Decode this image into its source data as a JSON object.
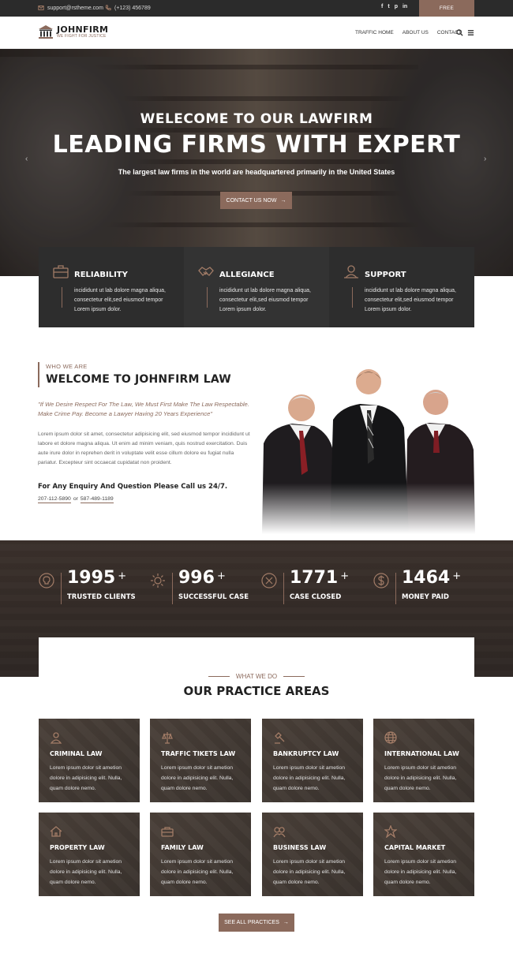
{
  "topbar": {
    "email": "support@rstheme.com",
    "phone": "(+123) 456789",
    "social": [
      "f",
      "t",
      "p",
      "in"
    ],
    "consult_label": "FREE CONSULTATION"
  },
  "header": {
    "logo_title": "JOHNFIRM",
    "logo_tagline": "WE FIGHT FOR JUSTICE",
    "nav": [
      "TRAFFIC HOME",
      "ABOUT US",
      "CONTACT"
    ]
  },
  "hero": {
    "subtitle": "WELECOME TO OUR LAWFIRM",
    "title": "LEADING FIRMS WITH EXPERT",
    "description": "The largest law firms in the world are headquartered primarily in the United States",
    "button_label": "CONTACT US NOW"
  },
  "features": [
    {
      "title": "RELIABILITY",
      "text": "incididunt ut lab dolore magna aliqua, consectetur elit,sed eiusmod tempor Lorem ipsum dolor.",
      "icon": "briefcase-icon"
    },
    {
      "title": "ALLEGIANCE",
      "text": "incididunt ut lab dolore magna aliqua, consectetur elit,sed eiusmod tempor Lorem ipsum dolor.",
      "icon": "handshake-icon"
    },
    {
      "title": "SUPPORT",
      "text": "incididunt ut lab dolore magna aliqua, consectetur elit,sed eiusmod tempor Lorem ipsum dolor.",
      "icon": "support-icon"
    }
  ],
  "about": {
    "kicker": "WHO WE ARE",
    "title": "WELCOME TO JOHNFIRM LAW",
    "quote": "\"If We Desire Respect For The Law, We Must First Make The Law Respectable. Make Crime Pay. Become a Lawyer Having 20 Years Experience\"",
    "body": "Lorem ipsum dolor sit amet, consectetur adipisicing elit, sed eiusmod tempor incididunt ut labore et dolore magna aliqua. Ut enim ad minim veniam, quis nostrud exercitation. Duis aute irure dolor in reprehen derit in voluptate velit esse cillum dolore eu fugiat nulla pariatur. Excepteur sint occaecat cupidatat non proident.",
    "cta": "For Any Enquiry And Question Please Call us 24/7.",
    "phone1": "207-112-5890",
    "or": "or",
    "phone2": "587-489-1189"
  },
  "counters": [
    {
      "number": "1995",
      "suffix": "+",
      "label": "TRUSTED CLIENTS",
      "icon": "lightbulb-icon"
    },
    {
      "number": "996",
      "suffix": "+",
      "label": "SUCCESSFUL CASE",
      "icon": "gear-icon"
    },
    {
      "number": "1771",
      "suffix": "+",
      "label": "CASE CLOSED",
      "icon": "close-circle-icon"
    },
    {
      "number": "1464",
      "suffix": "+",
      "label": "MONEY PAID",
      "icon": "dollar-icon"
    }
  ],
  "practice": {
    "kicker": "WHAT WE DO",
    "title": "OUR PRACTICE AREAS",
    "items": [
      {
        "title": "CRIMINAL LAW",
        "text": "Lorem ipsum dolor sit ametion dolore in adipisicing elit. Nulla, quam dolore nemo.",
        "icon": "criminal-icon"
      },
      {
        "title": "TRAFFIC TIKETS LAW",
        "text": "Lorem ipsum dolor sit ametion dolore in adipisicing elit. Nulla, quam dolore nemo.",
        "icon": "traffic-icon"
      },
      {
        "title": "BANKRUPTCY LAW",
        "text": "Lorem ipsum dolor sit ametion dolore in adipisicing elit. Nulla, quam dolore nemo.",
        "icon": "gavel-icon"
      },
      {
        "title": "INTERNATIONAL LAW",
        "text": "Lorem ipsum dolor sit ametion dolore in adipisicing elit. Nulla, quam dolore nemo.",
        "icon": "globe-icon"
      },
      {
        "title": "PROPERTY LAW",
        "text": "Lorem ipsum dolor sit ametion dolore in adipisicing elit. Nulla, quam dolore nemo.",
        "icon": "house-icon"
      },
      {
        "title": "FAMILY LAW",
        "text": "Lorem ipsum dolor sit ametion dolore in adipisicing elit. Nulla, quam dolore nemo.",
        "icon": "family-icon"
      },
      {
        "title": "BUSINESS LAW",
        "text": "Lorem ipsum dolor sit ametion dolore in adipisicing elit. Nulla, quam dolore nemo.",
        "icon": "business-icon"
      },
      {
        "title": "CAPITAL MARKET",
        "text": "Lorem ipsum dolor sit ametion dolore in adipisicing elit. Nulla, quam dolore nemo.",
        "icon": "capital-icon"
      }
    ],
    "see_all_label": "SEE ALL PRACTICES"
  },
  "colors": {
    "accent": "#8b6a5c",
    "dark": "#2d2d2d"
  }
}
